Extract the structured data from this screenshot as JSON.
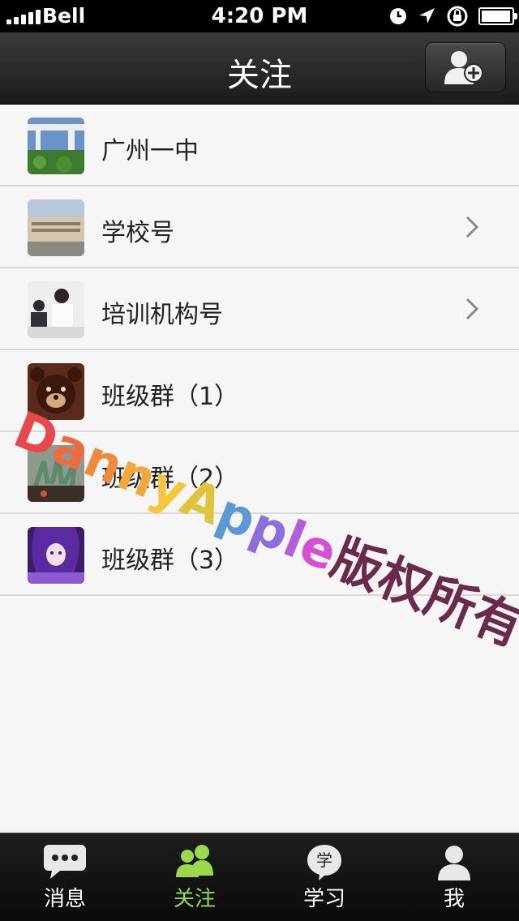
{
  "status_bar": {
    "carrier": "Bell",
    "time": "4:20 PM"
  },
  "navbar": {
    "title": "关注",
    "add_icon": "add-user-icon"
  },
  "list": [
    {
      "label": "广州一中",
      "has_chevron": false
    },
    {
      "label": "学校号",
      "has_chevron": true
    },
    {
      "label": "培训机构号",
      "has_chevron": true
    },
    {
      "label": "班级群（1）",
      "has_chevron": false
    },
    {
      "label": "班级群（2）",
      "has_chevron": false
    },
    {
      "label": "班级群（3）",
      "has_chevron": false
    }
  ],
  "watermark": {
    "letters": [
      "D",
      "a",
      "n",
      "n",
      "y",
      "A",
      "p",
      "p",
      "l",
      "e"
    ],
    "suffix": "版权所有",
    "colors": [
      "#e8474b",
      "#ef6a3c",
      "#f2893a",
      "#f5a83a",
      "#f5c53a",
      "#e0c43a",
      "#5a98d6",
      "#8a6fdc",
      "#b25fdd",
      "#d54ed6"
    ],
    "suffix_color": "#6b2a4a"
  },
  "tabs": [
    {
      "label": "消息",
      "icon": "chat-bubble-icon",
      "active": false
    },
    {
      "label": "关注",
      "icon": "contacts-icon",
      "active": true
    },
    {
      "label": "学习",
      "icon": "study-icon",
      "icon_text": "学",
      "active": false
    },
    {
      "label": "我",
      "icon": "person-icon",
      "active": false
    }
  ],
  "colors": {
    "active_tab": "#9bd84a",
    "navbar": "#2a2a2a",
    "background": "#f6f6f6"
  }
}
